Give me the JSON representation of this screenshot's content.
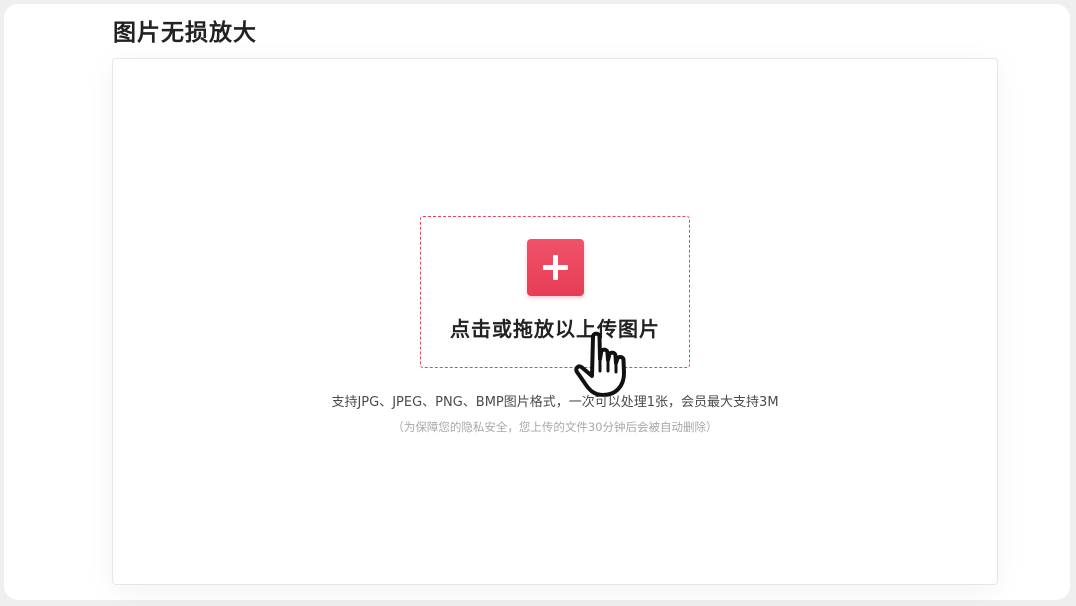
{
  "page": {
    "title": "图片无损放大"
  },
  "upload": {
    "drop_label": "点击或拖放以上传图片",
    "add_icon": "plus-icon",
    "cursor_icon": "hand-pointer-icon",
    "support_text": "支持JPG、JPEG、PNG、BMP图片格式，一次可以处理1张，会员最大支持3M",
    "privacy_text": "（为保障您的隐私安全，您上传的文件30分钟后会被自动删除）"
  },
  "colors": {
    "accent": "#e73c55",
    "dashed_border": "#e5465c",
    "title_text": "#222222",
    "hint_text": "#4a4a4a",
    "muted_text": "#a8a8a8"
  }
}
